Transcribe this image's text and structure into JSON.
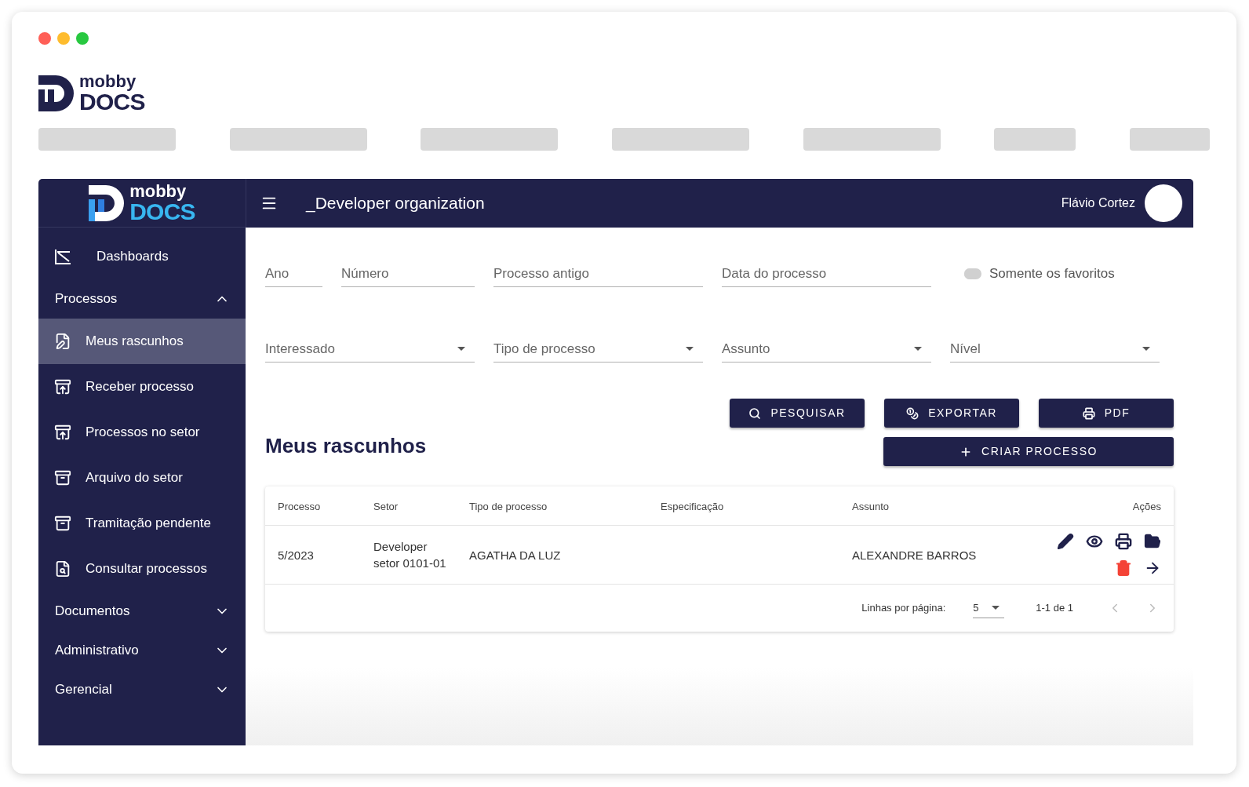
{
  "top_logo": {
    "line1": "mobby",
    "line2": "DOCS"
  },
  "sidebar": {
    "logo": {
      "line1": "mobby",
      "line2": "DOCS"
    },
    "items": [
      {
        "kind": "link",
        "label": "Dashboards",
        "selected": false
      },
      {
        "kind": "group",
        "label": "Processos",
        "expanded": true
      },
      {
        "kind": "link",
        "label": "Meus rascunhos",
        "selected": true
      },
      {
        "kind": "link",
        "label": "Receber processo",
        "selected": false
      },
      {
        "kind": "link",
        "label": "Processos no setor",
        "selected": false
      },
      {
        "kind": "link",
        "label": "Arquivo do setor",
        "selected": false
      },
      {
        "kind": "link",
        "label": "Tramitação pendente",
        "selected": false
      },
      {
        "kind": "link",
        "label": "Consultar processos",
        "selected": false
      },
      {
        "kind": "group",
        "label": "Documentos",
        "expanded": false
      },
      {
        "kind": "group",
        "label": "Administrativo",
        "expanded": false
      },
      {
        "kind": "group",
        "label": "Gerencial",
        "expanded": false
      }
    ]
  },
  "header": {
    "organization": "_Developer organization",
    "user": "Flávio Cortez"
  },
  "filters": {
    "row1": [
      {
        "placeholder": "Ano"
      },
      {
        "placeholder": "Número"
      },
      {
        "placeholder": "Processo antigo"
      },
      {
        "placeholder": "Data do processo"
      }
    ],
    "favorites_toggle": {
      "label": "Somente os favoritos",
      "on": false
    },
    "row2": [
      {
        "placeholder": "Interessado"
      },
      {
        "placeholder": "Tipo de processo"
      },
      {
        "placeholder": "Assunto"
      },
      {
        "placeholder": "Nível"
      }
    ]
  },
  "buttons": [
    {
      "kind": "search",
      "label": "PESQUISAR"
    },
    {
      "kind": "export",
      "label": "EXPORTAR"
    },
    {
      "kind": "pdf",
      "label": "PDF"
    },
    {
      "kind": "create",
      "label": "CRIAR PROCESSO"
    }
  ],
  "section_title": "Meus rascunhos",
  "table": {
    "columns": [
      "Processo",
      "Setor",
      "Tipo de processo",
      "Especificação",
      "Assunto",
      "Ações"
    ],
    "rows": [
      {
        "cells": [
          "5/2023",
          "Developer setor 0101-01",
          "AGATHA DA LUZ",
          "",
          "ALEXANDRE BARROS"
        ]
      }
    ],
    "pagination": {
      "rows_label": "Linhas por página:",
      "rows_value": "5",
      "range": "1-1 de 1"
    }
  }
}
